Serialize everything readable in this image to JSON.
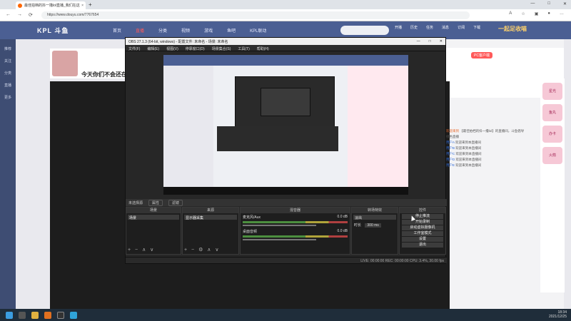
{
  "browser": {
    "tab_title": "最佳拍档的抖一撸lol直播_我们在这",
    "tab_close": "×",
    "new_tab": "+",
    "url": "https://www.douyu.com/7767654",
    "nav_back": "←",
    "nav_forward": "→",
    "nav_reload": "⟳",
    "win_min": "—",
    "win_max": "□",
    "win_close": "✕"
  },
  "site": {
    "logo": "KPL 斗鱼",
    "nav": [
      "首页",
      "直播",
      "分类",
      "视频",
      "游戏",
      "鱼吧",
      "KPL联动"
    ],
    "active_nav": "直播",
    "top_icons": [
      "开播",
      "历史",
      "任务",
      "消息",
      "订阅",
      "下载"
    ],
    "banner_right": "一起足收喵",
    "left_side": [
      "推荐",
      "关注",
      "分类",
      "直播",
      "更多"
    ],
    "follow_count": "12",
    "stream_title": "今天你们不会还在",
    "pc_client": "PC客户端"
  },
  "obs": {
    "title": "OBS 27.1.3 (64-bit, windows) - 配置文件: 未命名 - 场景: 未命名",
    "menu": [
      "文件(F)",
      "编辑(E)",
      "视图(V)",
      "停靠窗口(D)",
      "场景集合(S)",
      "工具(T)",
      "帮助(H)"
    ],
    "source_bar": {
      "label": "未选择源",
      "props": "属性",
      "filters": "滤镜"
    },
    "docks": {
      "scenes": {
        "header": "场景",
        "item": "场景"
      },
      "sources": {
        "header": "来源",
        "item": "显示器采集"
      },
      "mixer": {
        "header": "混音器",
        "tracks": [
          {
            "name": "麦克风/Aux",
            "level": "0.0 dB"
          },
          {
            "name": "桌面音频",
            "level": "0.0 dB"
          }
        ]
      },
      "transitions": {
        "header": "转场特效",
        "type": "淡出",
        "duration_label": "时长",
        "duration": "300 ms"
      },
      "controls": {
        "header": "控件",
        "buttons": [
          "停止推流",
          "开始录制",
          "启动虚拟摄像机",
          "工作室模式",
          "设置",
          "退出"
        ]
      }
    },
    "status": "LIVE: 00:00:00   REC: 00:00:00   CPU: 3.4%, 30.00 fps"
  },
  "chat": [
    {
      "user": "欢迎来到",
      "text": "【最佳拍档的抖一撸lol】的直播间，斗鱼倡导绿色直播",
      "color": "o"
    },
    {
      "user": "用户A",
      "text": "欢迎来到本直播间",
      "color": "b"
    },
    {
      "user": "用户B",
      "text": "欢迎来到本直播间",
      "color": "b"
    },
    {
      "user": "用户C",
      "text": "欢迎来到本直播间",
      "color": "b"
    },
    {
      "user": "用户D",
      "text": "欢迎来到本直播间",
      "color": "b"
    },
    {
      "user": "用户E",
      "text": "欢迎来到本直播间",
      "color": "b"
    }
  ],
  "gifts": [
    "星光",
    "鱼丸",
    "办卡",
    "火箭"
  ],
  "taskbar": {
    "time": "18:34",
    "date": "2021/12/25"
  },
  "colors": {
    "nav_bg": "#4b5f93",
    "obs_bg": "#272727",
    "taskbar": "#1f2d3a"
  }
}
